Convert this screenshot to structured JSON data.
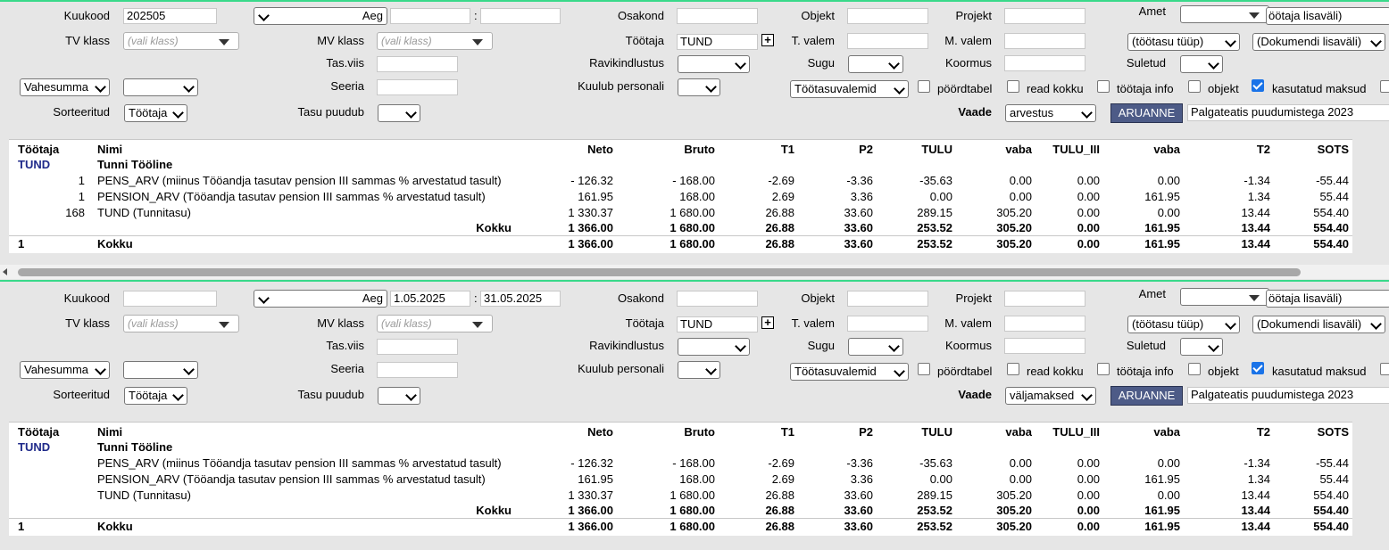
{
  "panels": [
    {
      "kuukood_label": "Kuukood",
      "kuukood_value": "202505",
      "aeg_label": "Aeg",
      "aeg_from": "",
      "aeg_sep": ":",
      "aeg_to": "",
      "osakond_label": "Osakond",
      "objekt_label": "Objekt",
      "projekt_label": "Projekt",
      "amet_label": "Amet",
      "amet_lisa": "öötaja lisaväli)",
      "tvklass_label": "TV klass",
      "tvklass_ph": "(vali klass)",
      "mvklass_label": "MV klass",
      "mvklass_ph": "(vali klass)",
      "tootaja_label": "Töötaja",
      "tootaja_value": "TUND",
      "tvalem_label": "T. valem",
      "mvalem_label": "M. valem",
      "tootasu_tyyp": "(töötasu tüüp)",
      "dok_lisavali": "(Dokumendi lisaväli)",
      "tasviis_label": "Tas.viis",
      "ravikindlustus_label": "Ravikindlustus",
      "sugu_label": "Sugu",
      "koormus_label": "Koormus",
      "suletud_label": "Suletud",
      "vahesumma": "Vahesumma",
      "seeria_label": "Seeria",
      "kuulub_label": "Kuulub personali",
      "tootasuvalemid": "Töötasuvalemid",
      "cb_pivot": "pöördtabel",
      "cb_read": "read kokku",
      "cb_info": "töötaja info",
      "cb_objekt": "objekt",
      "cb_maksud": "kasutatud maksud",
      "sorteeritud_label": "Sorteeritud",
      "sorteeritud_value": "Töötaja",
      "tasu_puudub_label": "Tasu puudub",
      "vaade_label": "Vaade",
      "vaade_value": "arvestus",
      "aruanne_label": "ARUANNE",
      "report_name": "Palgateatis puudumistega 2023"
    },
    {
      "kuukood_label": "Kuukood",
      "kuukood_value": "",
      "aeg_label": "Aeg",
      "aeg_from": "1.05.2025",
      "aeg_sep": ":",
      "aeg_to": "31.05.2025",
      "osakond_label": "Osakond",
      "objekt_label": "Objekt",
      "projekt_label": "Projekt",
      "amet_label": "Amet",
      "amet_lisa": "öötaja lisaväli)",
      "tvklass_label": "TV klass",
      "tvklass_ph": "(vali klass)",
      "mvklass_label": "MV klass",
      "mvklass_ph": "(vali klass)",
      "tootaja_label": "Töötaja",
      "tootaja_value": "TUND",
      "tvalem_label": "T. valem",
      "mvalem_label": "M. valem",
      "tootasu_tyyp": "(töötasu tüüp)",
      "dok_lisavali": "(Dokumendi lisaväli)",
      "tasviis_label": "Tas.viis",
      "ravikindlustus_label": "Ravikindlustus",
      "sugu_label": "Sugu",
      "koormus_label": "Koormus",
      "suletud_label": "Suletud",
      "vahesumma": "Vahesumma",
      "seeria_label": "Seeria",
      "kuulub_label": "Kuulub personali",
      "tootasuvalemid": "Töötasuvalemid",
      "cb_pivot": "pöördtabel",
      "cb_read": "read kokku",
      "cb_info": "töötaja info",
      "cb_objekt": "objekt",
      "cb_maksud": "kasutatud maksud",
      "sorteeritud_label": "Sorteeritud",
      "sorteeritud_value": "Töötaja",
      "tasu_puudub_label": "Tasu puudub",
      "vaade_label": "Vaade",
      "vaade_value": "väljamaksed",
      "aruanne_label": "ARUANNE",
      "report_name": "Palgateatis puudumistega 2023"
    }
  ],
  "tables": [
    {
      "headers": [
        "Töötaja",
        "Nimi",
        "Neto",
        "Bruto",
        "T1",
        "P2",
        "TULU",
        "vaba",
        "TULU_III",
        "vaba",
        "T2",
        "SOTS"
      ],
      "employee_code": "TUND",
      "employee_name": "Tunni Tööline",
      "rows": [
        {
          "qty": "1",
          "name": "PENS_ARV (miinus Tööandja tasutav pension III sammas % arvestatud tasult)",
          "v": [
            "- 126.32",
            "- 168.00",
            "-2.69",
            "-3.36",
            "-35.63",
            "0.00",
            "0.00",
            "0.00",
            "-1.34",
            "-55.44"
          ]
        },
        {
          "qty": "1",
          "name": "PENSION_ARV (Tööandja tasutav pension III sammas % arvestatud tasult)",
          "v": [
            "161.95",
            "168.00",
            "2.69",
            "3.36",
            "0.00",
            "0.00",
            "0.00",
            "161.95",
            "1.34",
            "55.44"
          ]
        },
        {
          "qty": "168",
          "name": "TUND (Tunnitasu)",
          "v": [
            "1 330.37",
            "1 680.00",
            "26.88",
            "33.60",
            "289.15",
            "305.20",
            "0.00",
            "0.00",
            "13.44",
            "554.40"
          ]
        }
      ],
      "subtotal_label": "Kokku",
      "subtotal": [
        "1 366.00",
        "1 680.00",
        "26.88",
        "33.60",
        "253.52",
        "305.20",
        "0.00",
        "161.95",
        "13.44",
        "554.40"
      ],
      "total_count": "1",
      "total_label": "Kokku",
      "total": [
        "1 366.00",
        "1 680.00",
        "26.88",
        "33.60",
        "253.52",
        "305.20",
        "0.00",
        "161.95",
        "13.44",
        "554.40"
      ]
    },
    {
      "headers": [
        "Töötaja",
        "Nimi",
        "Neto",
        "Bruto",
        "T1",
        "P2",
        "TULU",
        "vaba",
        "TULU_III",
        "vaba",
        "T2",
        "SOTS"
      ],
      "employee_code": "TUND",
      "employee_name": "Tunni Tööline",
      "rows": [
        {
          "qty": "",
          "name": "PENS_ARV (miinus Tööandja tasutav pension III sammas % arvestatud tasult)",
          "v": [
            "- 126.32",
            "- 168.00",
            "-2.69",
            "-3.36",
            "-35.63",
            "0.00",
            "0.00",
            "0.00",
            "-1.34",
            "-55.44"
          ]
        },
        {
          "qty": "",
          "name": "PENSION_ARV (Tööandja tasutav pension III sammas % arvestatud tasult)",
          "v": [
            "161.95",
            "168.00",
            "2.69",
            "3.36",
            "0.00",
            "0.00",
            "0.00",
            "161.95",
            "1.34",
            "55.44"
          ]
        },
        {
          "qty": "",
          "name": "TUND (Tunnitasu)",
          "v": [
            "1 330.37",
            "1 680.00",
            "26.88",
            "33.60",
            "289.15",
            "305.20",
            "0.00",
            "0.00",
            "13.44",
            "554.40"
          ]
        }
      ],
      "subtotal_label": "Kokku",
      "subtotal": [
        "1 366.00",
        "1 680.00",
        "26.88",
        "33.60",
        "253.52",
        "305.20",
        "0.00",
        "161.95",
        "13.44",
        "554.40"
      ],
      "total_count": "1",
      "total_label": "Kokku",
      "total": [
        "1 366.00",
        "1 680.00",
        "26.88",
        "33.60",
        "253.52",
        "305.20",
        "0.00",
        "161.95",
        "13.44",
        "554.40"
      ]
    }
  ]
}
